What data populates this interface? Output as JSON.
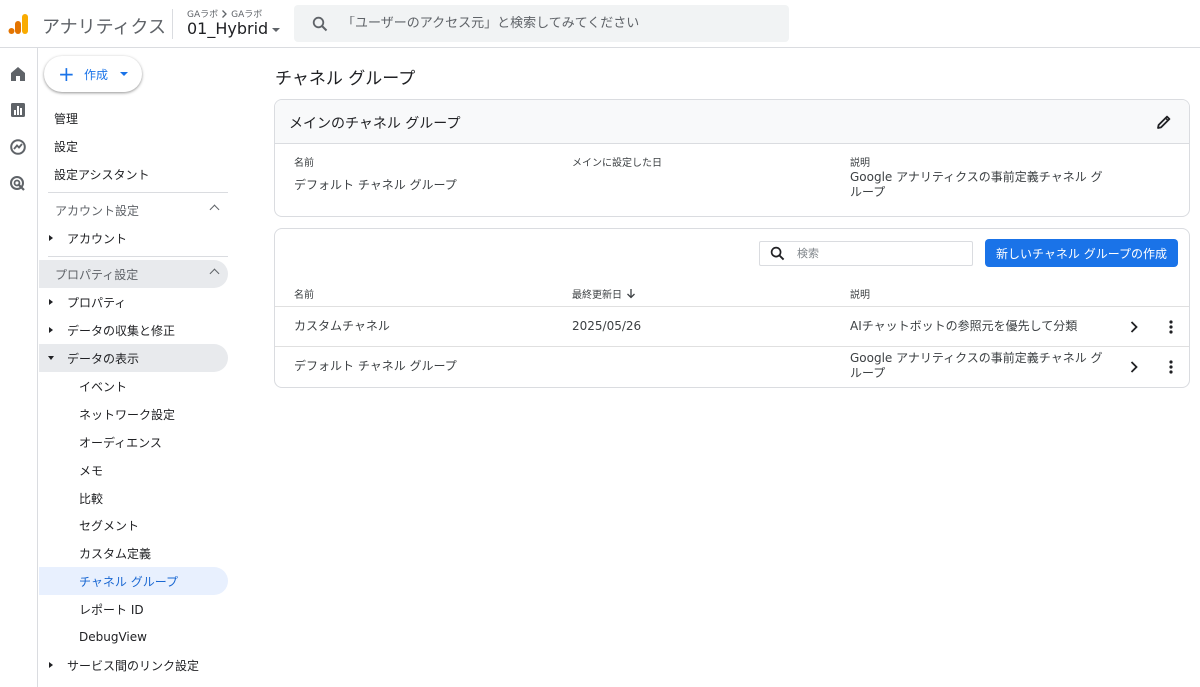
{
  "header": {
    "app_title": "アナリティクス",
    "breadcrumb_account": "GAラボ",
    "breadcrumb_property": "GAラボ",
    "property_name": "01_Hybrid",
    "search_placeholder": "「ユーザーのアクセス元」と検索してみてください"
  },
  "sidebar": {
    "create_label": "作成",
    "top_items": [
      "管理",
      "設定",
      "設定アシスタント"
    ],
    "account_section": "アカウント設定",
    "account_items": [
      "アカウント"
    ],
    "property_section": "プロパティ設定",
    "property_items": [
      "プロパティ",
      "データの収集と修正",
      "データの表示"
    ],
    "display_children": [
      "イベント",
      "ネットワーク設定",
      "オーディエンス",
      "メモ",
      "比較",
      "セグメント",
      "カスタム定義",
      "チャネル グループ",
      "レポート ID",
      "DebugView"
    ],
    "link_item": "サービス間のリンク設定"
  },
  "main": {
    "page_title": "チャネル グループ",
    "primary_card": {
      "title": "メインのチャネル グループ",
      "col_name": "名前",
      "col_date": "メインに設定した日",
      "col_desc": "説明",
      "row_name": "デフォルト チャネル グループ",
      "row_date": "",
      "row_desc": "Google アナリティクスの事前定義チャネル グループ"
    },
    "table": {
      "search_placeholder": "検索",
      "new_button": "新しいチャネル グループの作成",
      "col_name": "名前",
      "col_updated": "最終更新日",
      "col_desc": "説明",
      "rows": [
        {
          "name": "カスタムチャネル",
          "updated": "2025/05/26",
          "desc": "AIチャットボットの参照元を優先して分類"
        },
        {
          "name": "デフォルト チャネル グループ",
          "updated": "",
          "desc": "Google アナリティクスの事前定義チャネル グループ"
        }
      ]
    }
  },
  "colors": {
    "brand_orange": "#f9ab00",
    "brand_orange_dark": "#e37400",
    "accent_blue": "#1a73e8"
  }
}
